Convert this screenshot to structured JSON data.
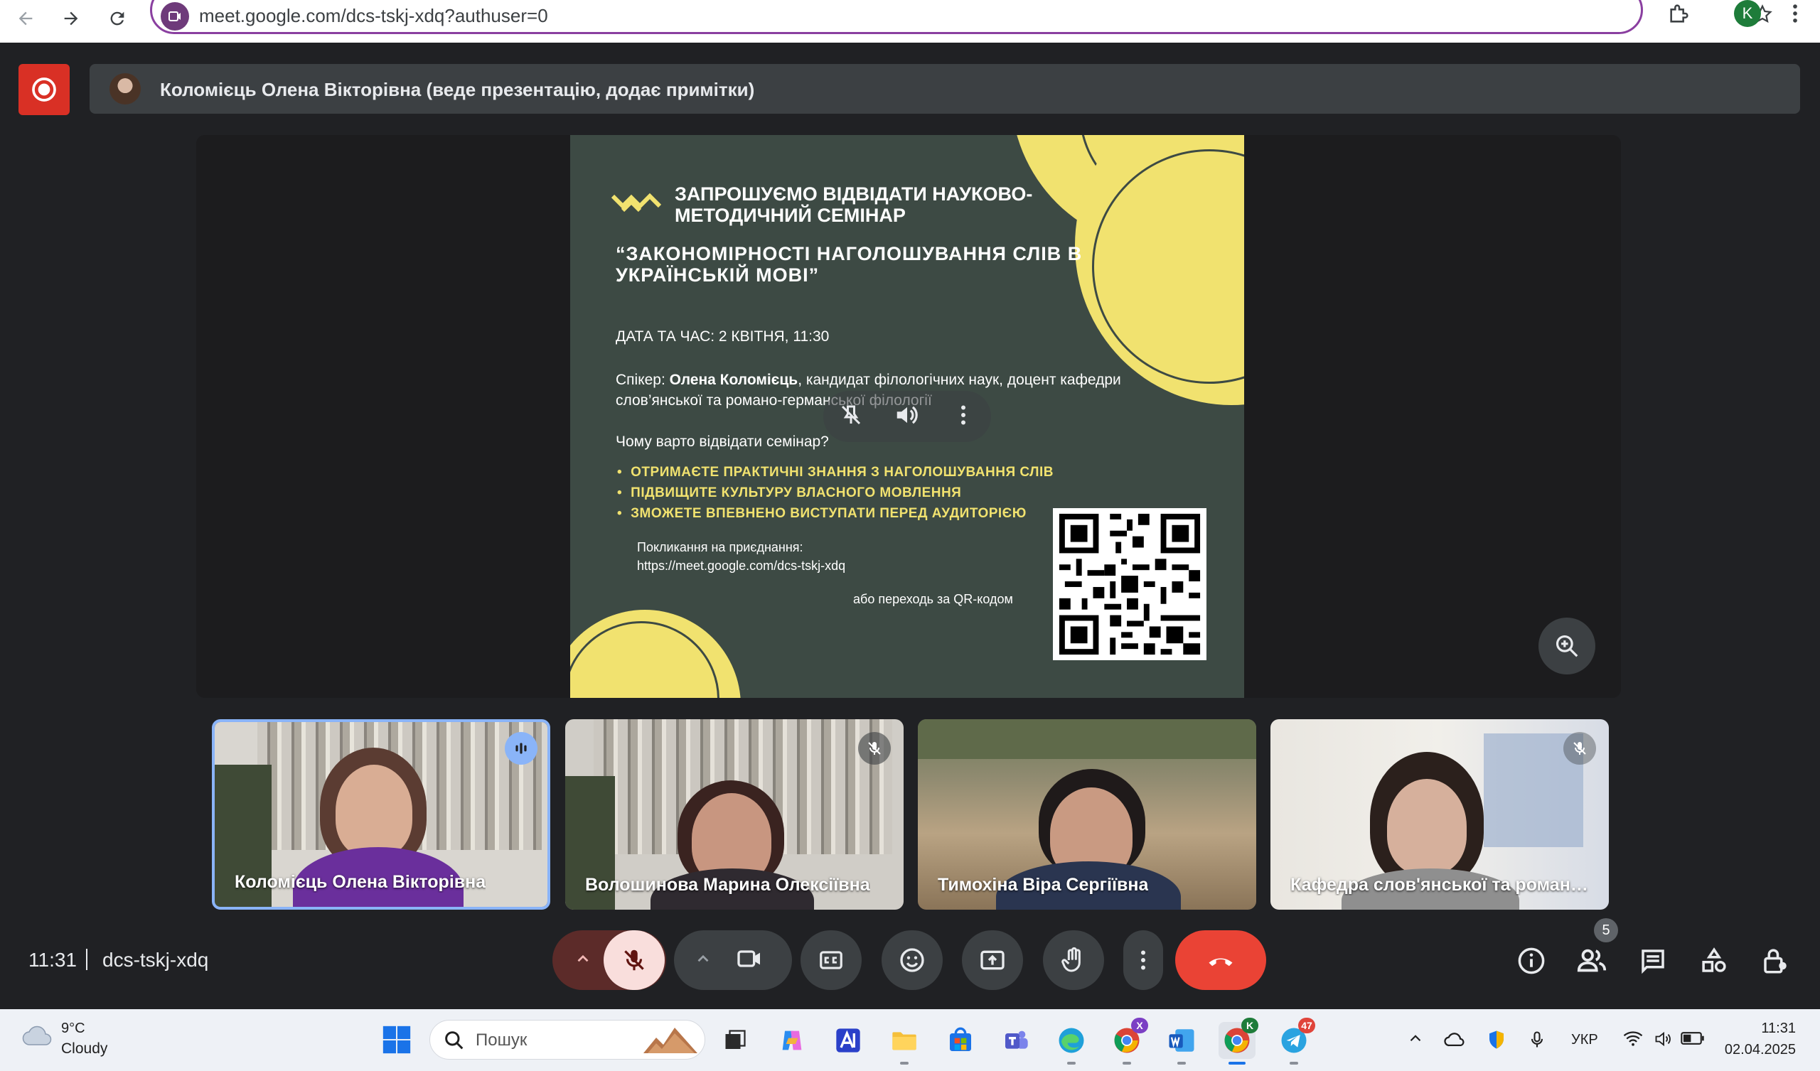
{
  "browser": {
    "url": "meet.google.com/dcs-tskj-xdq?authuser=0",
    "profile_initial": "K"
  },
  "presenter_banner": {
    "text": "Коломієць Олена Вікторівна (веде презентацію, додає примітки)"
  },
  "slide": {
    "invite": "ЗАПРОШУЄМО ВІДВІДАТИ НАУКОВО-МЕТОДИЧНИЙ СЕМІНАР",
    "title": "“ЗАКОНОМІРНОСТІ НАГОЛОШУВАННЯ СЛІВ В УКРАЇНСЬКІЙ МОВІ”",
    "date_time": "ДАТА ТА ЧАС: 2 КВІТНЯ, 11:30",
    "speaker_label": "Спікер: ",
    "speaker_name": "Олена Коломієць",
    "speaker_rest": ", кандидат філологічних наук, доцент кафедри слов’янської та романо-германської філології",
    "why_heading": "Чому варто відвідати семінар?",
    "bullets": [
      "ОТРИМАЄТЕ ПРАКТИЧНІ ЗНАННЯ З НАГОЛОШУВАННЯ СЛІВ",
      "ПІДВИЩИТЕ КУЛЬТУРУ ВЛАСНОГО МОВЛЕННЯ",
      "ЗМОЖЕТЕ ВПЕВНЕНО ВИСТУПАТИ ПЕРЕД АУДИТОРІЄЮ"
    ],
    "link_label": "Покликання на приєднання:",
    "link_url": "https://meet.google.com/dcs-tskj-xdq",
    "or_qr": "або переходь за QR-кодом"
  },
  "participants": [
    {
      "name": "Коломієць Олена Вікторівна",
      "status": "speaking"
    },
    {
      "name": "Волошинова Марина Олексіївна",
      "status": "muted"
    },
    {
      "name": "Тимохіна Віра Сергіївна",
      "status": "none"
    },
    {
      "name": "Кафедра слов'янської та романо...",
      "status": "muted"
    }
  ],
  "meeting": {
    "time": "11:31",
    "code": "dcs-tskj-xdq",
    "participant_count": "5"
  },
  "controls": [
    "audio-options",
    "mic-muted",
    "video-options",
    "camera",
    "captions",
    "reactions",
    "present-screen",
    "raise-hand",
    "more-options",
    "leave-call"
  ],
  "taskbar": {
    "weather_temp": "9°C",
    "weather_desc": "Cloudy",
    "search_placeholder": "Пошук",
    "language": "УКР",
    "clock_time": "11:31",
    "clock_date": "02.04.2025",
    "chrome_badge": "K",
    "chrome2_badge": "X",
    "telegram_badge": "47"
  },
  "colors": {
    "meet_bg": "#202124",
    "leave_red": "#ea4335",
    "slide_bg": "#3d4a44",
    "slide_yellow": "#f1e26f",
    "active_border": "#8ab4f8"
  }
}
